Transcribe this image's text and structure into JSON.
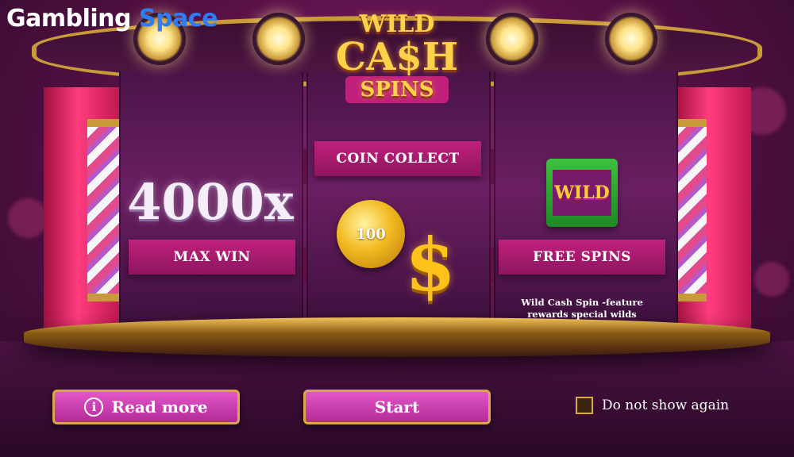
{
  "brand": {
    "part1": "Gambling",
    "part2": "Space"
  },
  "game_logo": {
    "line1": "WILD",
    "line2": "CA$H",
    "line3": "SPINS"
  },
  "features": {
    "max_win": {
      "value": "4000x",
      "label": "MAX WIN"
    },
    "coin_collect": {
      "label": "COIN COLLECT",
      "coin_value": "100",
      "symbol": "$"
    },
    "free_spins": {
      "symbol_text": "WILD",
      "label": "FREE SPINS",
      "description": "Wild Cash Spin -feature rewards special wilds"
    }
  },
  "buttons": {
    "read_more": "Read more",
    "start": "Start",
    "info_icon": "i"
  },
  "checkbox": {
    "label": "Do not show again",
    "checked": false
  },
  "colors": {
    "accent": "#c0207a",
    "gold": "#d9a84a",
    "brand_blue": "#2e7cf6"
  }
}
